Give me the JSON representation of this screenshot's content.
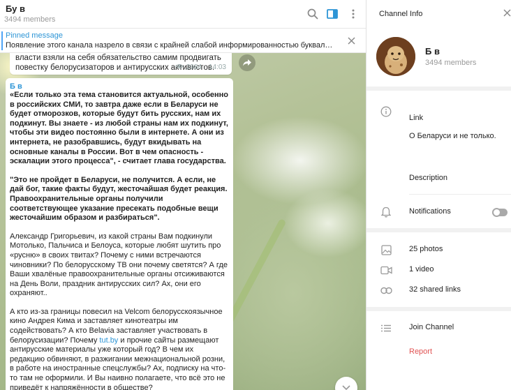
{
  "chat": {
    "title": "Бу                  в",
    "members": "3494 members",
    "pinned": {
      "label": "Pinned message",
      "text": "Появление этого канала назрело в связи с крайней слабой информированностью буквально вс..."
    },
    "message1": {
      "text": "власти взяли на себя обязательство самим продвигать повестку белорусизаторов и антирусских активистов.",
      "views": "2984",
      "time": "14:03"
    },
    "message2": {
      "author": "Б                   в",
      "p1": "«Если только эта тема становится актуальной, особенно в российских СМИ, то завтра даже если в Беларуси не будет отморозков, которые будут бить русских, нам их подкинут. Вы знаете - из любой страны нам их подкинут, чтобы эти видео постоянно были в интернете. А они из интернета, не разобравшись, будут вкидывать на основные каналы в России. Вот в чем опасность - эскалации этого процесса\", - считает глава государства.",
      "p2": "\"Это не пройдет в Беларуси, не получится. А если, не дай бог, такие факты будут, жесточайшая будет реакция. Правоохранительные органы получили соответствующее указание пресекать подобные вещи жесточайшим образом и разбираться\".",
      "p3": "Александр Григорьевич, из какой страны Вам подкинули Мотолько, Пальчиса и Белоуса, которые любят шутить про «русню» в своих твитах? Почему с ними встречаются чиновники? По белорусскому ТВ они почему светятся? А где Ваши хвалёные правоохранительные органы отсиживаются на День Воли, праздник антирусских сил? Ах, они его охраняют..",
      "p4_before_link": "А кто из-за границы повесил на Velcom белорусскоязычное кино Андрея Кима и заставляет кинотеатры им содействовать? А кто Belavia заставляет участвовать в белорусизации? Почему ",
      "p4_link": "tut.by",
      "p4_after_link": " и прочие сайты размещают антирусские материалы уже который год? В чем их редакцию обвиняют, в разжигании межнациональной розни, в работе на иностранные спецслужбы? Ах, подписку на что-то там не оформили. И Вы наивно полагаете, что всё это не приведёт к напряжённости в обществе?"
    }
  },
  "info": {
    "panel_title": "Channel Info",
    "channel_name": "Б                   в",
    "members": "3494 members",
    "link_label": "Link",
    "description_text": "О Беларуси и не только.",
    "description_label": "Description",
    "notifications_label": "Notifications",
    "notifications_on": false,
    "photos": "25 photos",
    "videos": "1 video",
    "links": "32 shared links",
    "join": "Join Channel",
    "report": "Report"
  },
  "colors": {
    "accent": "#2d95d6",
    "report": "#e05252",
    "pinned_bar": "#4ea4f6"
  }
}
